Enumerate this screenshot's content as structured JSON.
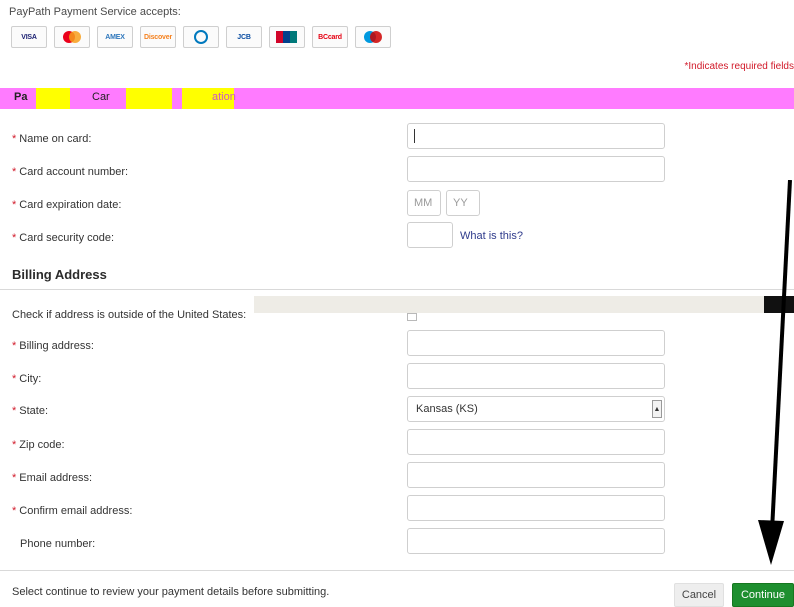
{
  "header": {
    "accepts_label": "PayPath Payment Service accepts:",
    "cards": [
      {
        "name": "visa-card-icon",
        "text": "VISA",
        "color": "#1a1f71"
      },
      {
        "name": "mastercard-card-icon",
        "text": "",
        "color": "#eb001b"
      },
      {
        "name": "amex-card-icon",
        "text": "AMEX",
        "color": "#2e77bc"
      },
      {
        "name": "discover-card-icon",
        "text": "Discover",
        "color": "#f58220"
      },
      {
        "name": "diners-card-icon",
        "text": "",
        "color": "#0079be"
      },
      {
        "name": "jcb-card-icon",
        "text": "JCB",
        "color": "#0b4ea2"
      },
      {
        "name": "unionpay-card-icon",
        "text": "",
        "color": "#d10429"
      },
      {
        "name": "bccard-card-icon",
        "text": "BCcard",
        "color": "#e50012"
      },
      {
        "name": "maestro-card-icon",
        "text": "",
        "color": "#cc0000"
      }
    ],
    "required_note": "*Indicates required fields"
  },
  "card_section": {
    "title_fragment_1": "Pa",
    "title_fragment_2": "Car",
    "title_fragment_3": "ation"
  },
  "card_fields": {
    "name_label": "Name on card:",
    "number_label": "Card account number:",
    "expiration_label": "Card expiration date:",
    "month_placeholder": "MM",
    "year_placeholder": "YY",
    "security_label": "Card security code:",
    "what_is_this": "What is this?"
  },
  "billing": {
    "title": "Billing Address",
    "outside_us_label": "Check if address is outside of the United States:",
    "address_label": "Billing address:",
    "city_label": "City:",
    "state_label": "State:",
    "state_value": "Kansas (KS)",
    "zip_label": "Zip code:",
    "email_label": "Email address:",
    "confirm_email_label": "Confirm email address:",
    "phone_label": "Phone number:"
  },
  "footer": {
    "hint": "Select continue to review your payment details before submitting.",
    "cancel_label": "Cancel",
    "continue_label": "Continue"
  },
  "colors": {
    "required": "#d11a2a",
    "continue": "#1e8f2f",
    "header_bar": "#ff7bff",
    "header_highlight": "#ffff00",
    "link": "#2f3b8c"
  }
}
